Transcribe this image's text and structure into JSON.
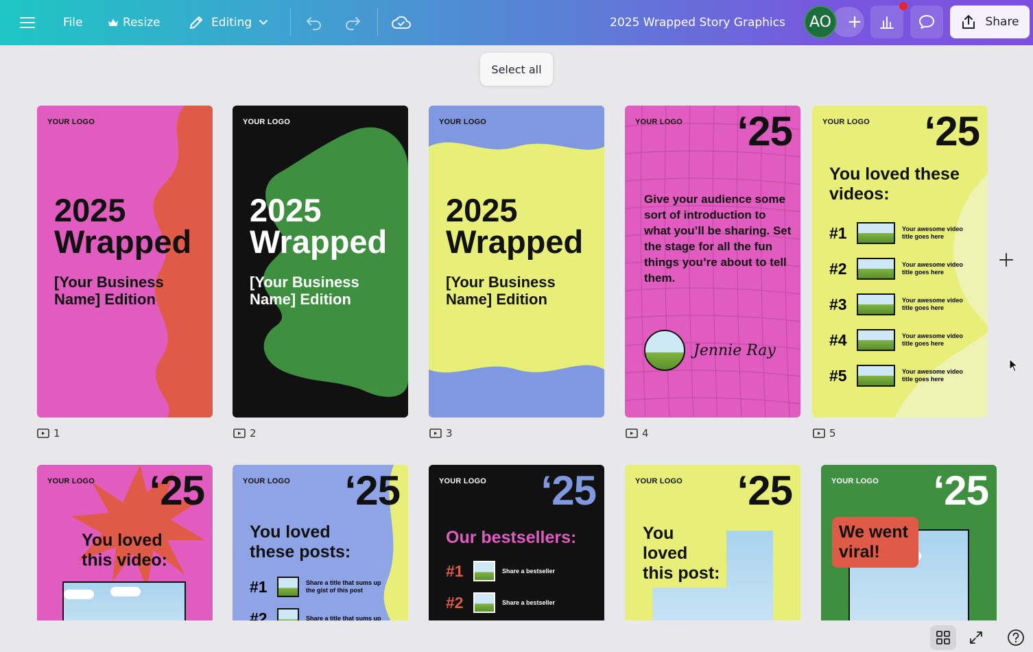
{
  "toolbar": {
    "file_label": "File",
    "resize_label": "Resize",
    "editing_label": "Editing",
    "doc_title": "2025 Wrapped Story Graphics",
    "avatar_initials": "AO",
    "share_label": "Share",
    "accent_gradient": [
      "#1ec6c4",
      "#7c4fe0"
    ]
  },
  "canvas": {
    "select_all_label": "Select all"
  },
  "pages": [
    {
      "number": "1",
      "logo": "YOUR LOGO",
      "title": "2025 Wrapped",
      "subtitle": "[Your Business Name] Edition",
      "bg": "#e05cbf",
      "accent": "#e05a48"
    },
    {
      "number": "2",
      "logo": "YOUR LOGO",
      "title": "2025 Wrapped",
      "subtitle": "[Your Business Name] Edition",
      "bg": "#111111",
      "accent": "#3f8f40"
    },
    {
      "number": "3",
      "logo": "YOUR LOGO",
      "title": "2025 Wrapped",
      "subtitle": "[Your Business Name] Edition",
      "bg": "#8098e0",
      "accent": "#e8ef78"
    },
    {
      "number": "4",
      "logo": "YOUR LOGO",
      "year": "‘25",
      "body": "Give your audience some sort of introduction to what you’ll be sharing. Set the stage for all the fun things you’re about to tell them.",
      "signature": "Jennie Ray",
      "bg": "#e05cbf"
    },
    {
      "number": "5",
      "logo": "YOUR LOGO",
      "year": "‘25",
      "title": "You loved these videos:",
      "items": [
        {
          "rank": "#1",
          "text": "Your awesome video title goes here"
        },
        {
          "rank": "#2",
          "text": "Your awesome video title goes here"
        },
        {
          "rank": "#3",
          "text": "Your awesome video title goes here"
        },
        {
          "rank": "#4",
          "text": "Your awesome video title goes here"
        },
        {
          "rank": "#5",
          "text": "Your awesome video title goes here"
        }
      ],
      "bg": "#e8ef78"
    }
  ],
  "row2": [
    {
      "logo": "YOUR LOGO",
      "year": "‘25",
      "title": "You loved this video:",
      "bg": "#e05cbf"
    },
    {
      "logo": "YOUR LOGO",
      "year": "‘25",
      "title": "You loved these posts:",
      "items": [
        {
          "rank": "#1",
          "text": "Share a title that sums up the gist of this post"
        },
        {
          "rank": "#2",
          "text": "Share a title that sums up"
        }
      ],
      "bg": "#8fa4e6"
    },
    {
      "logo": "YOUR LOGO",
      "year": "‘25",
      "title": "Our bestsellers:",
      "items": [
        {
          "rank": "#1",
          "text": "Share a bestseller"
        },
        {
          "rank": "#2",
          "text": "Share a bestseller"
        }
      ],
      "bg": "#111111"
    },
    {
      "logo": "YOUR LOGO",
      "year": "‘25",
      "title": "You loved this post:",
      "bg": "#e8ef78"
    },
    {
      "logo": "YOUR LOGO",
      "year": "‘25",
      "title": "We went viral!",
      "bg": "#3f8f40"
    }
  ],
  "icons": {
    "menu": "hamburger-menu-icon",
    "resize": "crown-icon",
    "editing": "pencil-icon",
    "undo": "undo-icon",
    "redo": "redo-icon",
    "cloud": "cloud-check-icon",
    "insights": "bar-chart-icon",
    "comment": "comment-bubble-icon",
    "share": "upload-icon",
    "grid": "grid-view-icon",
    "expand": "expand-icon",
    "help": "help-icon"
  }
}
